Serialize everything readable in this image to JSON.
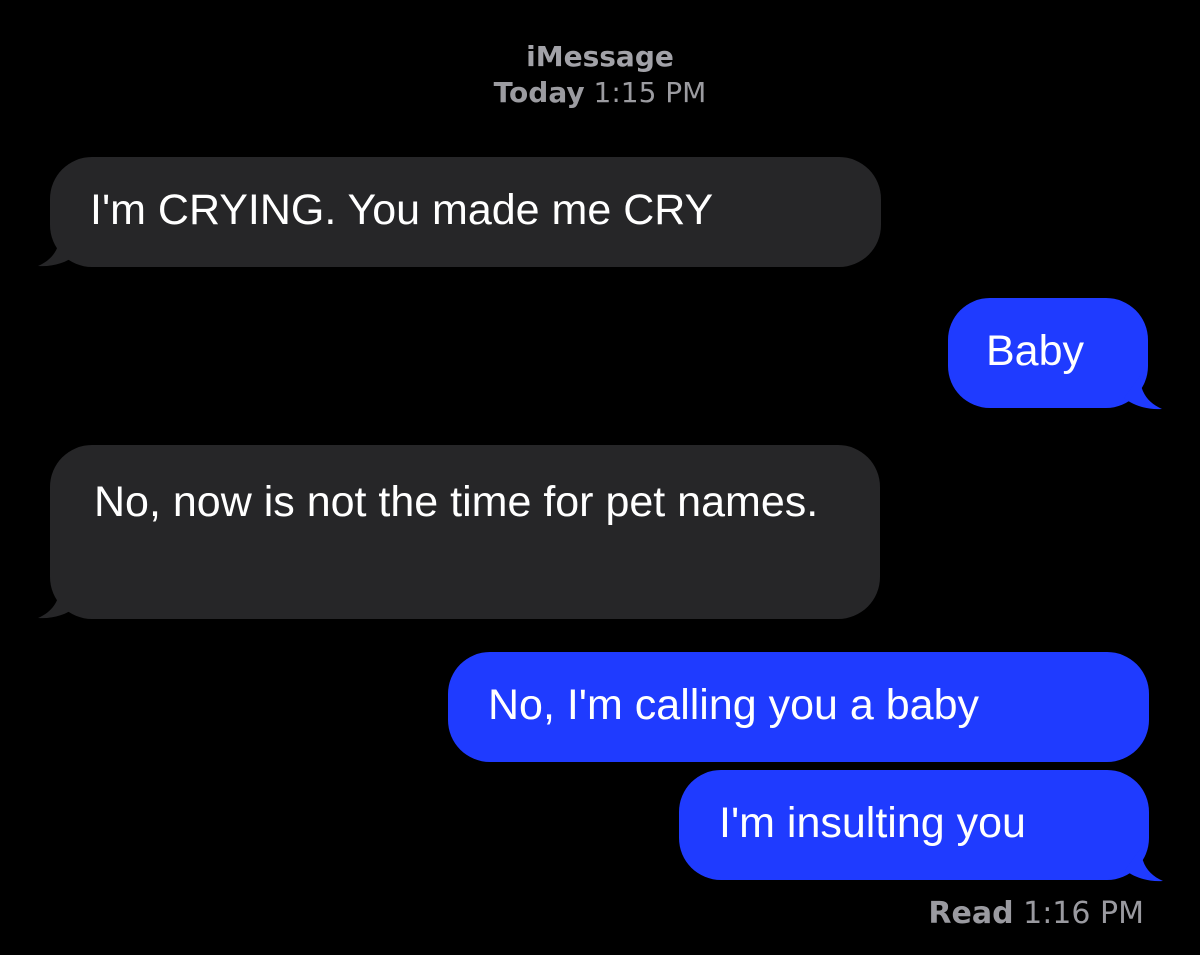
{
  "header": {
    "service": "iMessage",
    "day": "Today",
    "time": "1:15 PM"
  },
  "messages": [
    {
      "direction": "received",
      "text": "I'm CRYING. You made me CRY"
    },
    {
      "direction": "sent",
      "text": "Baby"
    },
    {
      "direction": "received",
      "text": "No, now is not the time for pet names."
    },
    {
      "direction": "sent",
      "text": "No, I'm calling you a baby"
    },
    {
      "direction": "sent",
      "text": "I'm insulting you"
    }
  ],
  "receipt": {
    "label": "Read",
    "time": "1:16 PM"
  },
  "colors": {
    "background": "#000000",
    "received_bubble": "#262628",
    "sent_bubble": "#1f3bff",
    "text": "#ffffff",
    "meta_text": "#9b9ba0"
  }
}
